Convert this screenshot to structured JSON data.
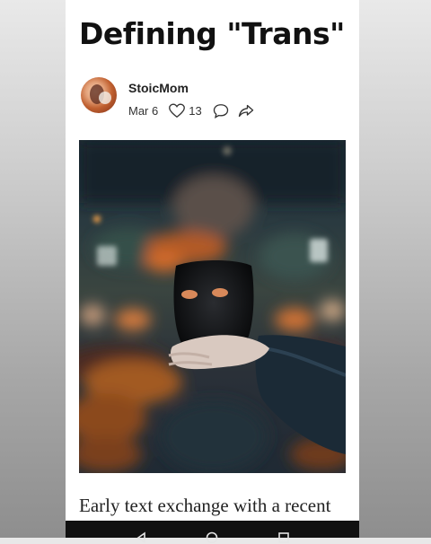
{
  "article": {
    "title": "Defining \"Trans\"",
    "author": "StoicMom",
    "date": "Mar 6",
    "likes": "13",
    "body_start": "Early text exchange with a recent"
  },
  "icons": {
    "like": "heart-outline-icon",
    "comment": "speech-bubble-icon",
    "share": "share-arrow-icon"
  },
  "image": {
    "description_name": "hero-image",
    "palette": [
      "#1d2b33",
      "#e07a32",
      "#0d0f12",
      "#8a5a3a"
    ]
  },
  "system_nav": [
    "back",
    "home",
    "recents"
  ]
}
